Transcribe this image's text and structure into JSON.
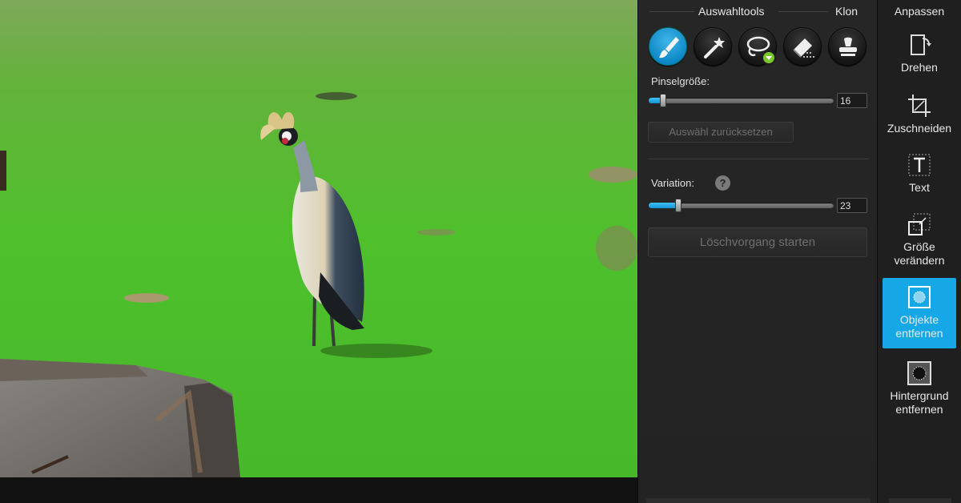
{
  "tool_panel": {
    "section_select_tools": "Auswahltools",
    "section_clone": "Klon",
    "tools": [
      {
        "name": "brush-icon",
        "active": true
      },
      {
        "name": "magic-wand-icon",
        "active": false
      },
      {
        "name": "lasso-icon",
        "active": false,
        "has_dropdown": true
      },
      {
        "name": "eraser-icon",
        "active": false
      },
      {
        "name": "clone-stamp-icon",
        "active": false
      }
    ],
    "brush_size_label": "Pinselgröße:",
    "brush_size_value": "16",
    "brush_size_fraction": 0.08,
    "reset_selection_label": "Auswähl zurücksetzen",
    "variation_label": "Variation:",
    "variation_help": "?",
    "variation_value": "23",
    "variation_fraction": 0.16,
    "start_button_label": "Löschvorgang starten"
  },
  "nav": {
    "title": "Anpassen",
    "items": [
      {
        "label": "Drehen",
        "icon": "rotate-icon",
        "active": false
      },
      {
        "label": "Zuschneiden",
        "icon": "crop-icon",
        "active": false
      },
      {
        "label": "Text",
        "icon": "text-icon",
        "active": false
      },
      {
        "label": "Größe verändern",
        "icon": "resize-icon",
        "active": false
      },
      {
        "label": "Objekte entfernen",
        "icon": "remove-objects-icon",
        "active": true
      },
      {
        "label": "Hintergrund entfernen",
        "icon": "remove-background-icon",
        "active": false
      }
    ]
  },
  "colors": {
    "accent": "#16a7e6",
    "panel_bg": "#262626",
    "badge_green": "#7bc62a"
  }
}
